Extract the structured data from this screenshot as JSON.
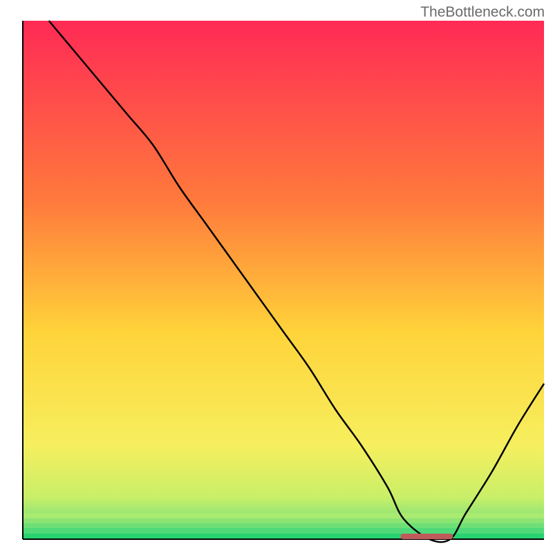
{
  "watermark": "TheBottleneck.com",
  "chart_data": {
    "type": "line",
    "title": "",
    "xlabel": "",
    "ylabel": "",
    "xlim": [
      0,
      100
    ],
    "ylim": [
      0,
      100
    ],
    "grid": false,
    "legend": false,
    "annotations": [
      {
        "name": "min-marker",
        "x_start": 73,
        "x_end": 82,
        "y": 0,
        "color": "#bf5b5b"
      }
    ],
    "background_gradient": {
      "top": "#ff2a55",
      "mid": "#ffd33a",
      "bottom": "#1fd66b"
    },
    "series": [
      {
        "name": "bottleneck-curve",
        "x": [
          5,
          10,
          15,
          20,
          25,
          30,
          35,
          40,
          45,
          50,
          55,
          60,
          65,
          70,
          73,
          78,
          82,
          85,
          90,
          95,
          100
        ],
        "y": [
          100,
          94,
          88,
          82,
          76,
          68,
          61,
          54,
          47,
          40,
          33,
          25,
          18,
          10,
          4,
          0,
          0,
          5,
          13,
          22,
          30
        ]
      }
    ]
  }
}
